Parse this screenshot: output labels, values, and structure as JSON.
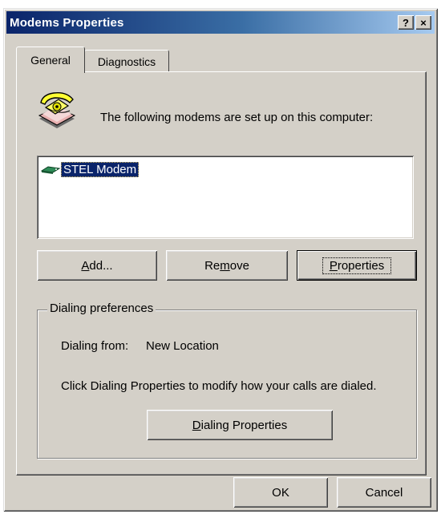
{
  "window": {
    "title": "Modems Properties",
    "help_button": "?",
    "close_button": "×"
  },
  "tabs": [
    {
      "label": "General",
      "active": true
    },
    {
      "label": "Diagnostics",
      "active": false
    }
  ],
  "general": {
    "intro_text": "The following modems are set up on this computer:",
    "modems": [
      {
        "label": "STEL Modem",
        "selected": true
      }
    ],
    "buttons": {
      "add": {
        "pre": "",
        "key": "A",
        "post": "dd..."
      },
      "remove": {
        "pre": "Re",
        "key": "m",
        "post": "ove"
      },
      "properties": {
        "pre": "",
        "key": "P",
        "post": "roperties"
      }
    },
    "dialing": {
      "legend": "Dialing preferences",
      "from_label": "Dialing from:",
      "from_value": "New Location",
      "note": "Click Dialing Properties to modify how your calls are dialed.",
      "button": {
        "pre": "",
        "key": "D",
        "post": "ialing Properties"
      }
    }
  },
  "footer": {
    "ok": "OK",
    "cancel": "Cancel"
  },
  "icons": {
    "phone": "telephone-icon",
    "modem": "modem-icon"
  },
  "colors": {
    "title_start": "#0a246a",
    "title_end": "#a6caf0",
    "selection": "#0a246a",
    "face": "#d4d0c8"
  }
}
